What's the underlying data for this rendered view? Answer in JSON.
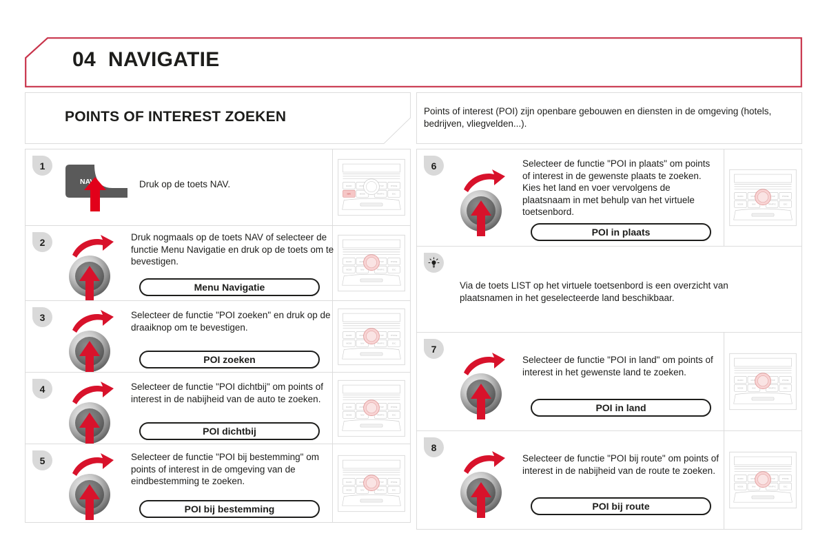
{
  "header": {
    "chapter_number": "04",
    "chapter_title": "NAVIGATIE",
    "accent_color": "#c8344b"
  },
  "section": {
    "title": "POINTS OF INTEREST ZOEKEN",
    "intro": "Points of interest (POI) zijn openbare gebouwen en diensten in de omgeving (hotels, bedrijven, vliegvelden...)."
  },
  "left_column": {
    "steps": [
      {
        "number": "1",
        "illustration": "nav-key-icon",
        "key_label": "NAV",
        "text": "Druk op de toets NAV.",
        "pill": null,
        "thumbnail": "radio-panel-nav-highlight"
      },
      {
        "number": "2",
        "illustration": "rotary-knob-icon",
        "text": "Druk nogmaals op de toets NAV of selecteer de functie Menu Navigatie en druk op de toets om te bevestigen.",
        "pill": "Menu Navigatie",
        "thumbnail": "radio-panel-knob-highlight"
      },
      {
        "number": "3",
        "illustration": "rotary-knob-icon",
        "text": "Selecteer de functie \"POI zoeken\" en druk op de draaiknop om te bevestigen.",
        "pill": "POI zoeken",
        "thumbnail": "radio-panel-knob-highlight"
      },
      {
        "number": "4",
        "illustration": "rotary-knob-icon",
        "text": "Selecteer de functie \"POI dichtbij\" om points of interest in de nabijheid van de auto te zoeken.",
        "pill": "POI dichtbij",
        "thumbnail": "radio-panel-knob-highlight"
      },
      {
        "number": "5",
        "illustration": "rotary-knob-icon",
        "text": "Selecteer de functie \"POI bij bestemming\" om points of interest in de omgeving van de eindbestemming te zoeken.",
        "pill": "POI bij bestemming",
        "thumbnail": "radio-panel-knob-highlight"
      }
    ]
  },
  "right_column": {
    "steps": [
      {
        "number": "6",
        "illustration": "rotary-knob-icon",
        "text": "Selecteer de functie \"POI in plaats\" om points of interest in de gewenste plaats te zoeken. Kies het land en voer vervolgens de plaatsnaam in met behulp van het virtuele toetsenbord.",
        "pill": "POI in plaats",
        "thumbnail": "radio-panel-knob-highlight"
      },
      {
        "number": "7",
        "illustration": "rotary-knob-icon",
        "text": "Selecteer de functie \"POI in land\" om points of interest in het gewenste land te zoeken.",
        "pill": "POI in land",
        "thumbnail": "radio-panel-knob-highlight"
      },
      {
        "number": "8",
        "illustration": "rotary-knob-icon",
        "text": "Selecteer de functie \"POI bij route\" om points of interest in de nabijheid van de route te zoeken.",
        "pill": "POI bij route",
        "thumbnail": "radio-panel-knob-highlight"
      }
    ],
    "tip": {
      "icon": "light-bulb-icon",
      "text": "Via de toets LIST op het virtuele toetsenbord is een overzicht van plaatsnamen in het geselecteerde land beschikbaar."
    }
  },
  "radio_panel": {
    "button_labels_row1": [
      "RADIO",
      "MUSIC",
      "SETUP",
      "PHONE"
    ],
    "button_labels_row2": [
      "MODE",
      "NAV",
      "TRAFFIC",
      "ESC"
    ]
  }
}
